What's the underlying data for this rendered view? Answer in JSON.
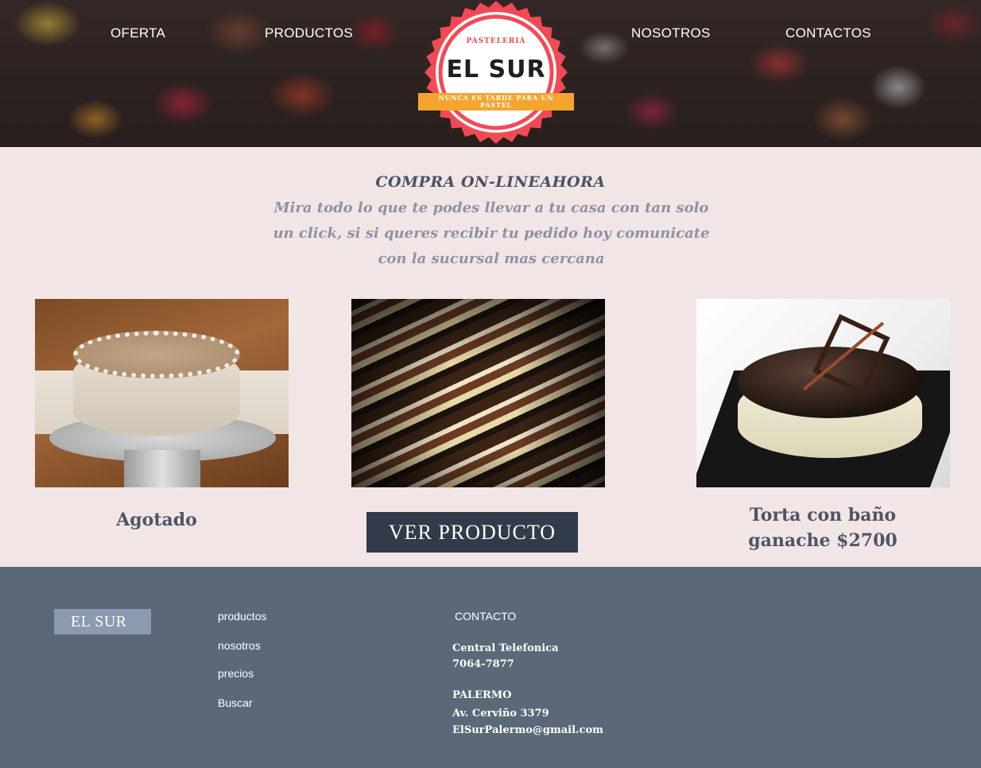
{
  "nav": {
    "items": [
      "OFERTA",
      "PRODUCTOS",
      "NOSOTROS",
      "CONTACTOS"
    ]
  },
  "logo": {
    "pre_title": "PASTELERIA",
    "name": "EL SUR",
    "tagline": "NUNCA ES TARDE PARA UN PASTEL"
  },
  "intro": {
    "title": "COMPRA ON-LINEAHORA",
    "text": "Mira todo lo que te podes llevar a tu casa con tan solo un click, si si queres recibir tu pedido hoy comunicate con la sucursal mas cercana"
  },
  "products": {
    "item1_caption": "Agotado",
    "button_label": "VER PRODUCTO",
    "item3_caption": "Torta con baño ganache $2700"
  },
  "footer": {
    "brand": "EL SUR",
    "links": [
      "productos",
      "nosotros",
      "precios",
      "Buscar"
    ],
    "contact_heading": "CONTACTO",
    "phone_label": "Central Telefonica",
    "phone_number": "7064-7877",
    "branch_name": "PALERMO",
    "branch_address": "Av. Cerviño 3379",
    "branch_email": "ElSurPalermo@gmail.com"
  },
  "colors": {
    "page_bg": "#f2e5e6",
    "footer_bg": "#5a6878",
    "button_bg": "#323b49",
    "logo_red": "#f24a55",
    "logo_ribbon": "#f5a52e"
  }
}
